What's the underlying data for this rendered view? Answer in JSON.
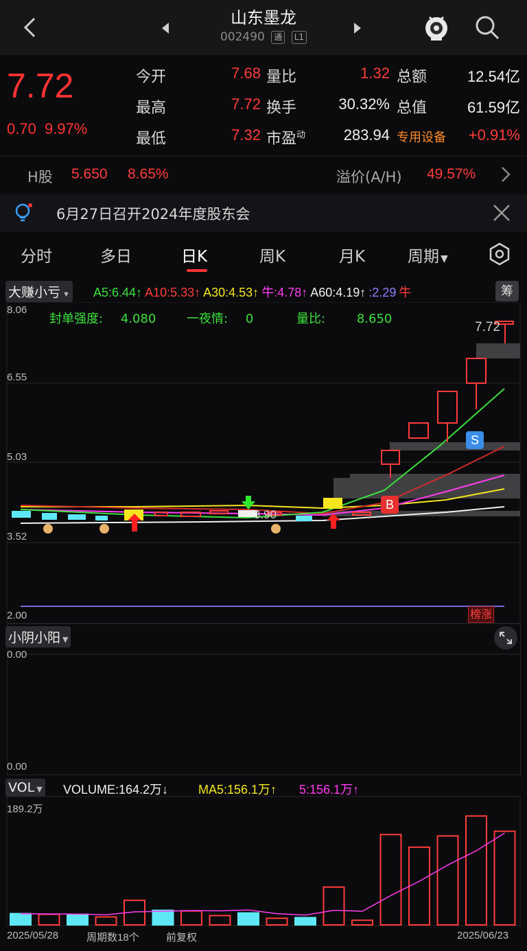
{
  "header": {
    "title": "山东墨龙",
    "code": "002490",
    "tag_tong": "通",
    "tag_level": "L1"
  },
  "quote": {
    "price": "7.72",
    "change_abs": "0.70",
    "change_pct": "9.97%",
    "fields": [
      {
        "label": "今开",
        "value": "7.68"
      },
      {
        "label": "最高",
        "value": "7.72"
      },
      {
        "label": "最低",
        "value": "7.32"
      },
      {
        "label": "量比",
        "value": "1.32"
      },
      {
        "label": "换手",
        "value": "30.32%"
      },
      {
        "label": "市盈",
        "sup": "动",
        "value": "283.94"
      },
      {
        "label": "总额",
        "value": "12.54亿"
      },
      {
        "label": "总值",
        "value": "61.59亿"
      },
      {
        "label": "专用设备",
        "value": "+0.91%"
      }
    ]
  },
  "hk": {
    "label": "H股",
    "price": "5.650",
    "pct": "8.65%",
    "premium_label": "溢价(A/H)",
    "premium_value": "49.57%"
  },
  "notice": {
    "text": "6月27日召开2024年度股东会"
  },
  "tabs": [
    {
      "label": "分时"
    },
    {
      "label": "多日"
    },
    {
      "label": "日K"
    },
    {
      "label": "周K"
    },
    {
      "label": "月K"
    },
    {
      "label": "周期"
    }
  ],
  "indicator": {
    "selector": "大赚小亏",
    "items": [
      {
        "text": "A5:6.44↑",
        "color": "#3de03d"
      },
      {
        "text": "A10:5.33↑",
        "color": "#ff3b3b"
      },
      {
        "text": "A30:4.53↑",
        "color": "#f5e61f"
      },
      {
        "text": "牛:4.78↑",
        "color": "#ff3cf0"
      },
      {
        "text": "A60:4.19↑",
        "color": "#f0f0f0"
      },
      {
        "text": ":2.29",
        "color": "#8f7fff"
      },
      {
        "text": "牛",
        "color": "#ff3b3b"
      }
    ],
    "chip_button": "筹"
  },
  "main_chart": {
    "y_labels": [
      "8.06",
      "6.55",
      "5.03",
      "3.52",
      "2.00"
    ],
    "stats": [
      {
        "label": "封单强度:",
        "value": "4.080"
      },
      {
        "label": "一夜情:",
        "value": "0"
      },
      {
        "label": "量比:",
        "value": "8.650"
      }
    ],
    "last_price_label": "7.72",
    "mid_label": "3.90",
    "b_marker": "B",
    "s_marker": "S",
    "bottom_tag": "榜涨"
  },
  "sub_chart": {
    "selector": "小阴小阳",
    "y_top": "0.00",
    "y_bottom": "0.00"
  },
  "volume": {
    "selector": "VOL",
    "volume_text": "VOLUME:164.2万↓",
    "ma5_text": "MA5:156.1万↑",
    "m5_text": "5:156.1万↑",
    "y_max": "189.2万",
    "start_date": "2025/05/28",
    "period_count": "周期数18个",
    "adjust": "前复权",
    "end_date": "2025/06/23"
  },
  "chart_data": {
    "type": "bar",
    "title": "",
    "xlabel": "",
    "ylabel": "",
    "ylim": [
      0,
      189.2
    ],
    "series": [
      {
        "values": [
          17,
          16,
          16,
          12,
          37,
          22,
          21,
          14,
          18,
          10,
          11,
          57,
          7,
          136,
          117,
          134,
          164,
          141
        ],
        "colors": [
          "up",
          "down",
          "up",
          "down",
          "down",
          "up",
          "down",
          "down",
          "up",
          "down",
          "up",
          "down",
          "down",
          "down",
          "down",
          "down",
          "down",
          "down"
        ]
      }
    ]
  }
}
